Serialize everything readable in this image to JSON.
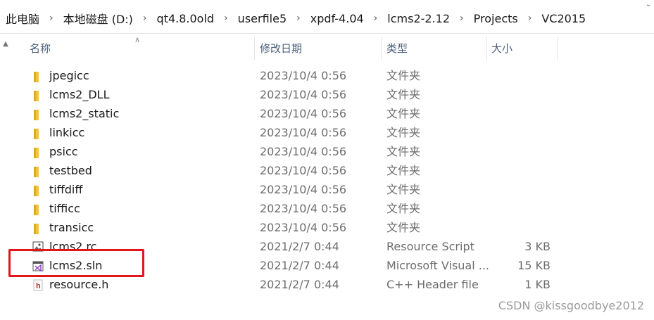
{
  "breadcrumbs": [
    "此电脑",
    "本地磁盘 (D:)",
    "qt4.8.0old",
    "userfile5",
    "xpdf-4.04",
    "lcms2-2.12",
    "Projects",
    "VC2015"
  ],
  "columns": {
    "name": "名称",
    "date": "修改日期",
    "type": "类型",
    "size": "大小"
  },
  "rows": [
    {
      "name": "jpegicc",
      "date": "2023/10/4 0:56",
      "type": "文件夹",
      "size": "",
      "icon": "folder-icon"
    },
    {
      "name": "lcms2_DLL",
      "date": "2023/10/4 0:56",
      "type": "文件夹",
      "size": "",
      "icon": "folder-icon"
    },
    {
      "name": "lcms2_static",
      "date": "2023/10/4 0:56",
      "type": "文件夹",
      "size": "",
      "icon": "folder-icon"
    },
    {
      "name": "linkicc",
      "date": "2023/10/4 0:56",
      "type": "文件夹",
      "size": "",
      "icon": "folder-icon"
    },
    {
      "name": "psicc",
      "date": "2023/10/4 0:56",
      "type": "文件夹",
      "size": "",
      "icon": "folder-icon"
    },
    {
      "name": "testbed",
      "date": "2023/10/4 0:56",
      "type": "文件夹",
      "size": "",
      "icon": "folder-icon"
    },
    {
      "name": "tiffdiff",
      "date": "2023/10/4 0:56",
      "type": "文件夹",
      "size": "",
      "icon": "folder-icon"
    },
    {
      "name": "tifficc",
      "date": "2023/10/4 0:56",
      "type": "文件夹",
      "size": "",
      "icon": "folder-icon"
    },
    {
      "name": "transicc",
      "date": "2023/10/4 0:56",
      "type": "文件夹",
      "size": "",
      "icon": "folder-icon"
    },
    {
      "name": "lcms2.rc",
      "date": "2021/2/7 0:44",
      "type": "Resource Script",
      "size": "3 KB",
      "icon": "resource-script-icon"
    },
    {
      "name": "lcms2.sln",
      "date": "2021/2/7 0:44",
      "type": "Microsoft Visual ...",
      "size": "15 KB",
      "icon": "visual-studio-solution-icon"
    },
    {
      "name": "resource.h",
      "date": "2021/2/7 0:44",
      "type": "C++ Header file",
      "size": "1 KB",
      "icon": "cpp-header-icon"
    }
  ],
  "colors": {
    "highlight_box": "#e2151b",
    "folder": "#f4c242",
    "header_text": "#4c607a"
  },
  "watermark": "CSDN @kissgoodbye2012"
}
